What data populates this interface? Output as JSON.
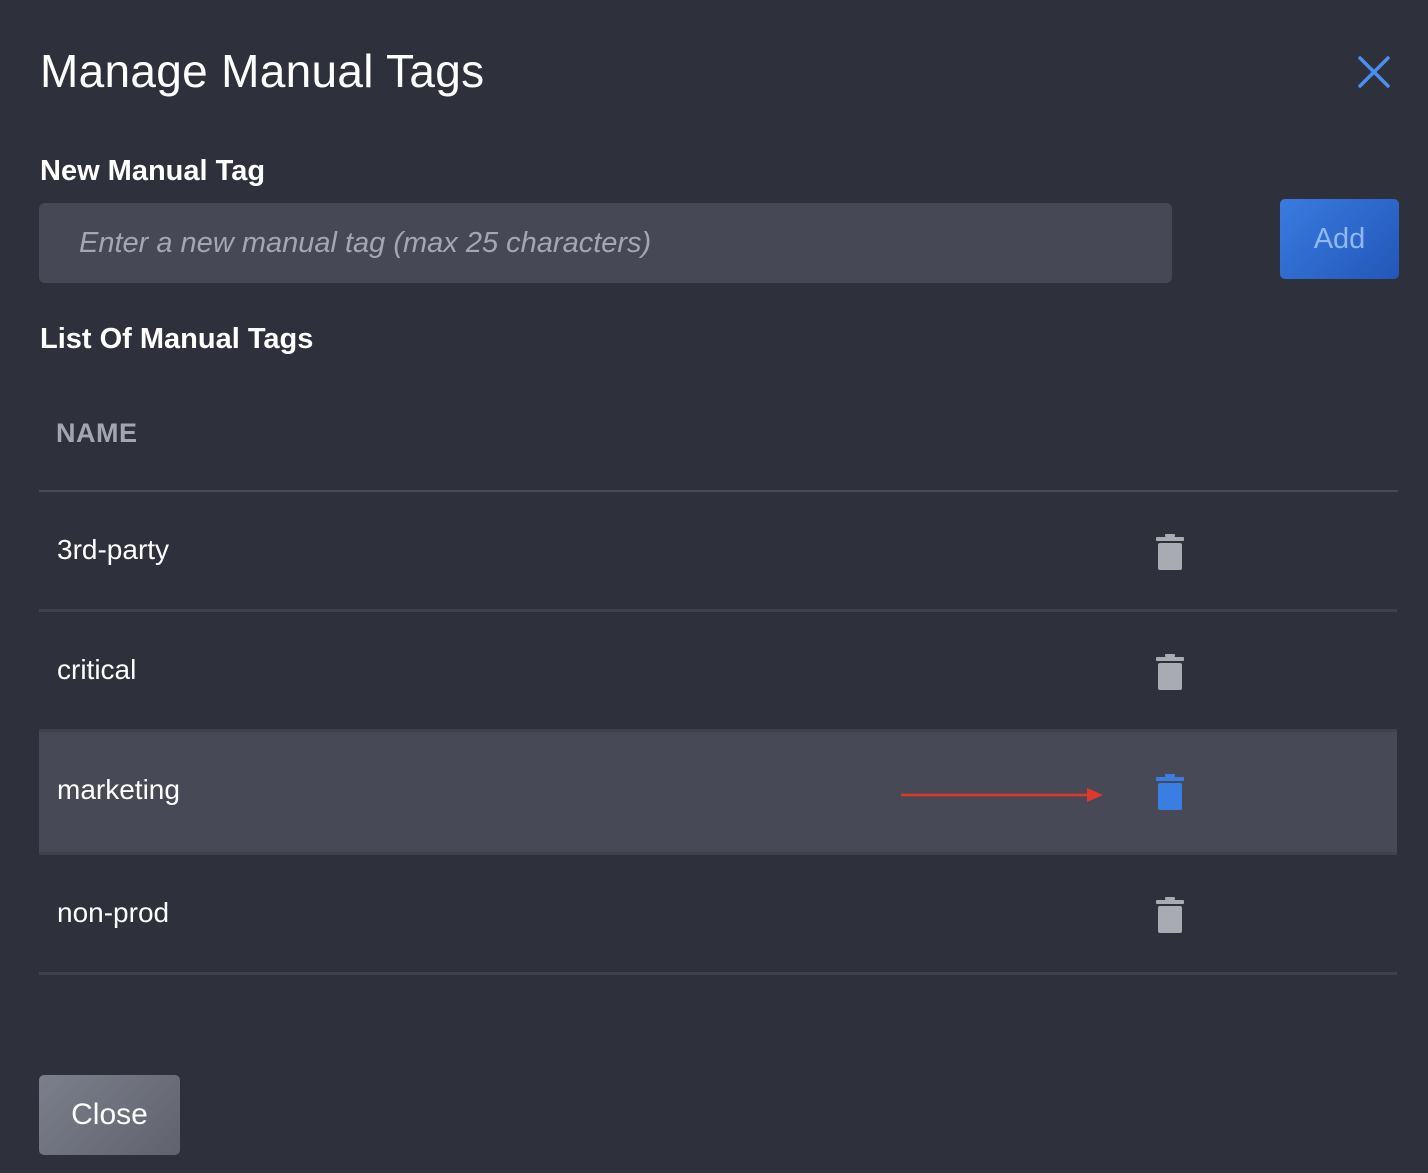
{
  "dialog": {
    "title": "Manage Manual Tags",
    "close_icon": "close-icon"
  },
  "new_tag": {
    "label": "New Manual Tag",
    "placeholder": "Enter a new manual tag (max 25 characters)",
    "value": "",
    "add_label": "Add"
  },
  "tag_list": {
    "label": "List Of Manual Tags",
    "column_header": "NAME",
    "rows": [
      {
        "name": "3rd-party",
        "icon": "trash-icon",
        "highlighted": false
      },
      {
        "name": "critical",
        "icon": "trash-icon",
        "highlighted": false
      },
      {
        "name": "marketing",
        "icon": "trash-icon",
        "highlighted": true
      },
      {
        "name": "non-prod",
        "icon": "trash-icon",
        "highlighted": false
      }
    ]
  },
  "footer": {
    "close_label": "Close"
  },
  "colors": {
    "background": "#2e313b",
    "accent": "#3a7be0",
    "trash_default": "#a9abb3",
    "trash_active": "#3b7ee3",
    "annotation_arrow": "#e0382b"
  }
}
